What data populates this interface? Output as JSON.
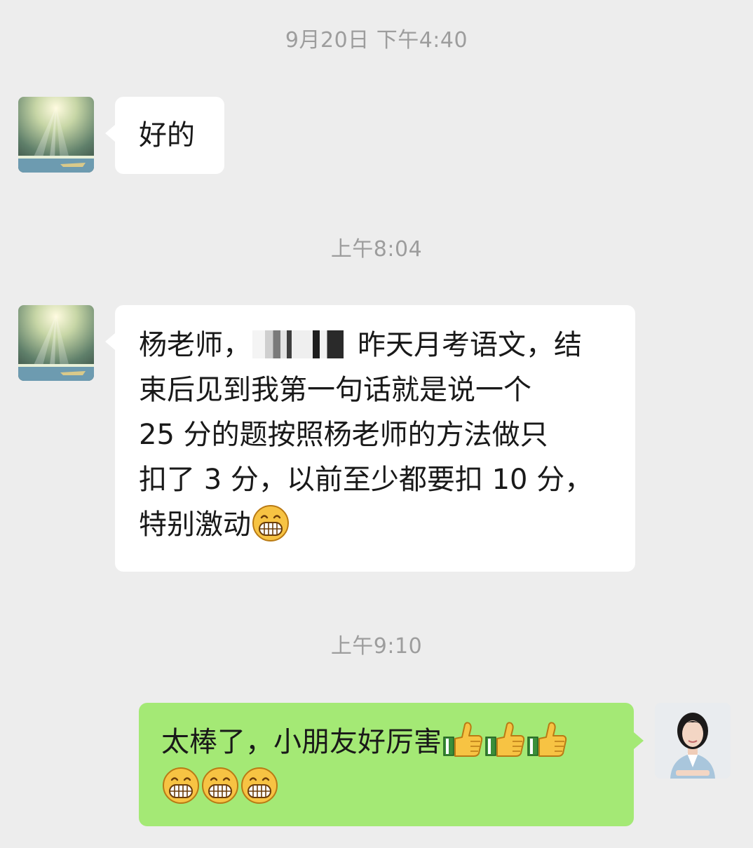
{
  "timestamps": {
    "t1": "9月20日 下午4:40",
    "t2": "上午8:04",
    "t3": "上午9:10"
  },
  "messages": {
    "m1": {
      "text": "好的"
    },
    "m2": {
      "line1_pre": "杨老师，",
      "line1_post": "昨天月考语文，结",
      "line2": "束后见到我第一句话就是说一个",
      "line3": "25 分的题按照杨老师的方法做只",
      "line4": "扣了 3 分，以前至少都要扣 10 分，",
      "line5": "特别激动"
    },
    "m3": {
      "text": "太棒了，小朋友好厉害"
    }
  },
  "icons": {
    "grin": "grinning-face-emoji",
    "thumb": "thumbs-up-emoji",
    "avatar_contact": "sunlight-sea-painting",
    "avatar_self": "woman-portrait"
  },
  "colors": {
    "background": "#ededed",
    "incoming_bubble": "#ffffff",
    "outgoing_bubble": "#a4e975",
    "timestamp": "#9d9d9d"
  }
}
